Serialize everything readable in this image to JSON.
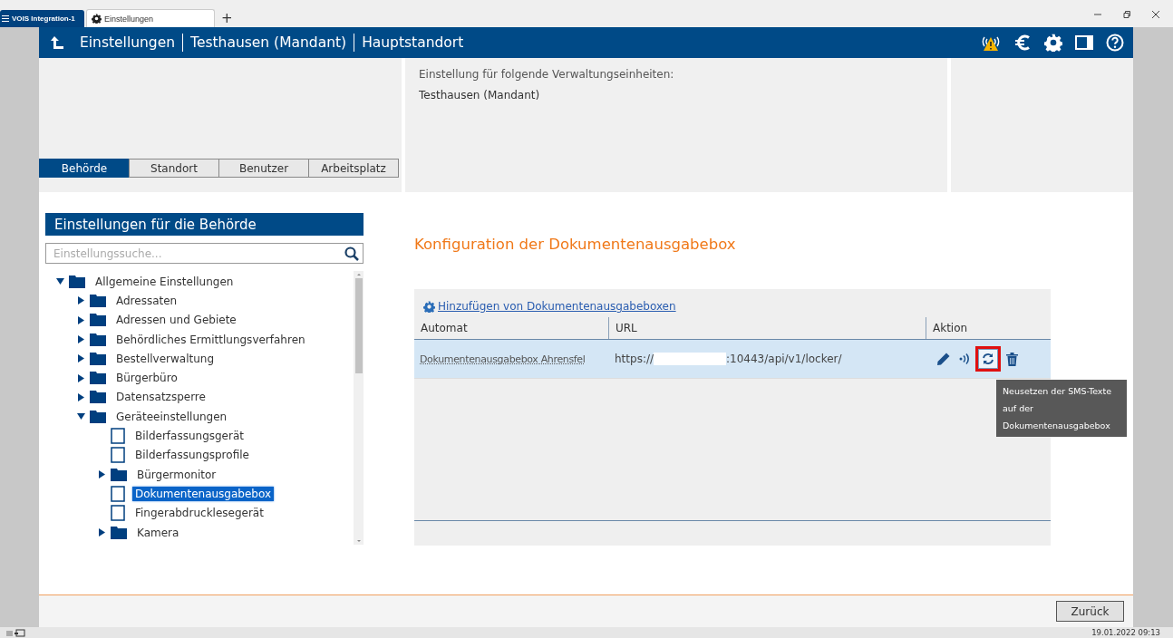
{
  "browser_tabs": [
    {
      "label": "VOIS Integration-1",
      "kind": "app",
      "selected": false
    },
    {
      "label": "Einstellungen",
      "kind": "page",
      "selected": true
    }
  ],
  "new_tab": "+",
  "header": {
    "crumbs": [
      "Einstellungen",
      "Testhausen (Mandant)",
      "Hauptstandort"
    ]
  },
  "scope_tabs": [
    {
      "label": "Behörde",
      "selected": true
    },
    {
      "label": "Standort",
      "selected": false
    },
    {
      "label": "Benutzer",
      "selected": false
    },
    {
      "label": "Arbeitsplatz",
      "selected": false
    }
  ],
  "scope_info": {
    "label": "Einstellung für folgende Verwaltungseinheiten:",
    "value": "Testhausen (Mandant)"
  },
  "sidebar": {
    "title": "Einstellungen für die Behörde",
    "search": {
      "placeholder": "Einstellungssuche..."
    },
    "tree": [
      {
        "label": "Allgemeine Einstellungen",
        "kind": "folder",
        "expanded": true,
        "selected": false,
        "children": [
          {
            "label": "Adressaten",
            "kind": "folder",
            "expanded": false,
            "selected": false
          },
          {
            "label": "Adressen und Gebiete",
            "kind": "folder",
            "expanded": false,
            "selected": false
          },
          {
            "label": "Behördliches Ermittlungsverfahren",
            "kind": "folder",
            "expanded": false,
            "selected": false
          },
          {
            "label": "Bestellverwaltung",
            "kind": "folder",
            "expanded": false,
            "selected": false
          },
          {
            "label": "Bürgerbüro",
            "kind": "folder",
            "expanded": false,
            "selected": false
          },
          {
            "label": "Datensatzsperre",
            "kind": "folder",
            "expanded": false,
            "selected": false
          },
          {
            "label": "Geräteeinstellungen",
            "kind": "folder",
            "expanded": true,
            "selected": false,
            "children": [
              {
                "label": "Bilderfassungsgerät",
                "kind": "file",
                "selected": false
              },
              {
                "label": "Bilderfassungsprofile",
                "kind": "file",
                "selected": false
              },
              {
                "label": "Bürgermonitor",
                "kind": "folder",
                "expanded": false,
                "selected": false
              },
              {
                "label": "Dokumentenausgabebox",
                "kind": "file",
                "selected": true
              },
              {
                "label": "Fingerabdrucklesegerät",
                "kind": "file",
                "selected": false
              },
              {
                "label": "Kamera",
                "kind": "folder",
                "expanded": false,
                "selected": false
              }
            ]
          }
        ]
      }
    ]
  },
  "content": {
    "title": "Konfiguration der Dokumentenausgabebox",
    "add_link": "Hinzufügen von Dokumentenausgabeboxen",
    "columns": [
      "Automat",
      "URL",
      "Aktion"
    ],
    "rows": [
      {
        "automat": "Dokumentenausgabebox Ahrensfel",
        "url_start": "https://",
        "url_end": ":10443/api/v1/locker/",
        "selected": true
      }
    ],
    "tooltip": "Neusetzen der SMS-Texte auf der Dokumentenausgabebox"
  },
  "footer": {
    "back_button": "Zurück"
  },
  "status_bar": {
    "datetime": "19.01.2022 09:13"
  }
}
